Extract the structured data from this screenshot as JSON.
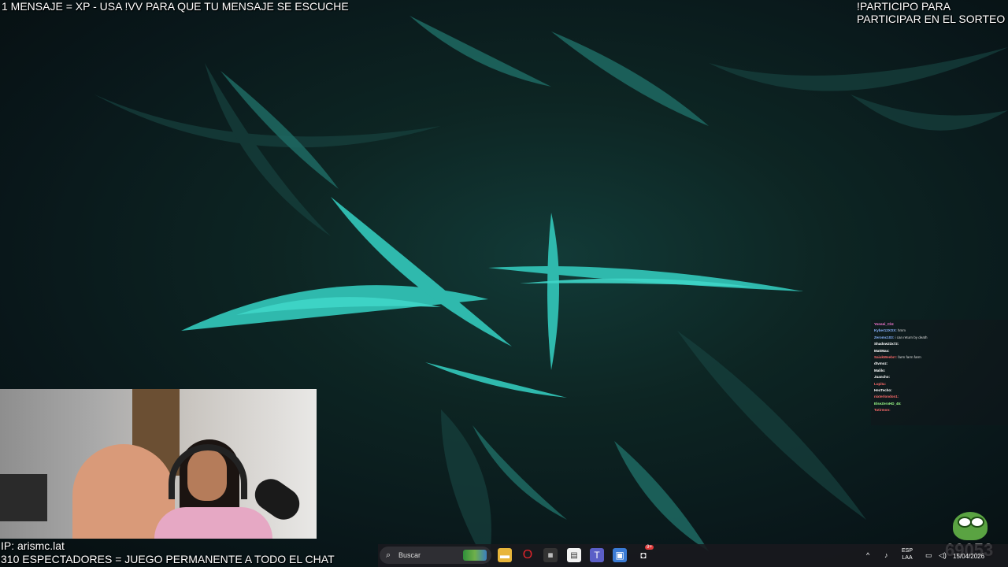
{
  "overlay": {
    "top_left": "1 MENSAJE = XP - USA !VV PARA QUE TU MENSAJE SE ESCUCHE",
    "top_right_line1": "!PARTICIPO PARA",
    "top_right_line2": "PARTICIPAR EN EL SORTEO",
    "ip": "IP: arismc.lat",
    "viewers": "310 ESPECTADORES = JUEGO PERMANENTE A TODO EL CHAT"
  },
  "chat": {
    "messages": [
      {
        "user": "Yonsei_Cl4",
        "color": "#ff7ad9",
        "text": ""
      },
      {
        "user": "Kyber12XOX",
        "color": "#8ab4ff",
        "text": "hmm"
      },
      {
        "user": "Zeromc103",
        "color": "#8ab4ff",
        "text": "i can return by death"
      },
      {
        "user": "Shadow23x72",
        "color": "#ffffff",
        "text": ""
      },
      {
        "user": "MattMax",
        "color": "#ffffff",
        "text": ""
      },
      {
        "user": "SaiukWeebrr",
        "color": "#ff6b6b",
        "text": "farm farm farm"
      },
      {
        "user": "dtvmoz",
        "color": "#ffffff",
        "text": ""
      },
      {
        "user": "Malilo",
        "color": "#ffffff",
        "text": ""
      },
      {
        "user": "Juancho",
        "color": "#ffffff",
        "text": ""
      },
      {
        "user": "Lupita",
        "color": "#ff6b6b",
        "text": ""
      },
      {
        "user": "HexTecho",
        "color": "#ffffff",
        "text": ""
      },
      {
        "user": "nixterlondon1",
        "color": "#ff6b6b",
        "text": ""
      },
      {
        "user": "ElseZeroHD_45",
        "color": "#9dff8a",
        "text": ""
      },
      {
        "user": "Tutirmon",
        "color": "#ff6b6b",
        "text": ""
      }
    ]
  },
  "points": "69053",
  "taskbar": {
    "search_placeholder": "Buscar",
    "lang_line1": "ESP",
    "lang_line2": "LAA",
    "date": "15/04/2026",
    "notification_badge": "9+"
  }
}
